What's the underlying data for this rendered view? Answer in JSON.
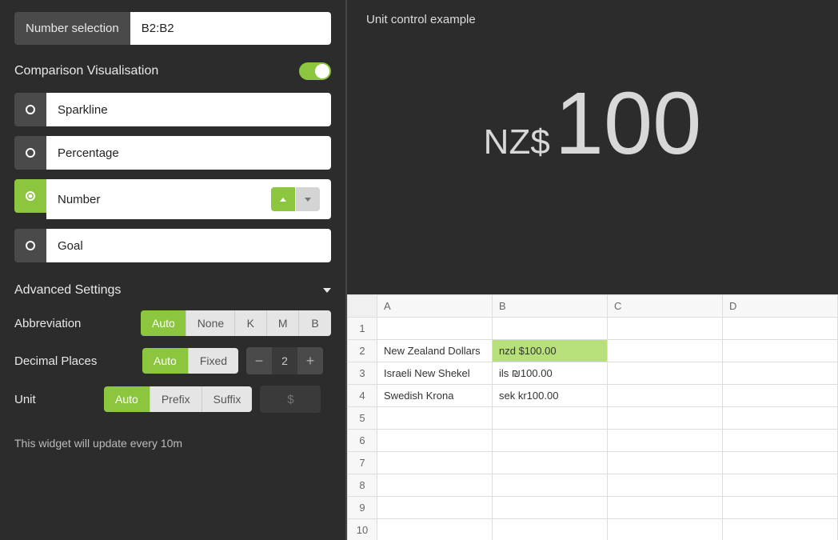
{
  "selection": {
    "label": "Number selection",
    "value": "B2:B2"
  },
  "comparison": {
    "title": "Comparison Visualisation",
    "enabled": true,
    "options": [
      {
        "label": "Sparkline",
        "selected": false,
        "expandable": false
      },
      {
        "label": "Percentage",
        "selected": false,
        "expandable": false
      },
      {
        "label": "Number",
        "selected": true,
        "expandable": true
      },
      {
        "label": "Goal",
        "selected": false,
        "expandable": false
      }
    ]
  },
  "advanced": {
    "title": "Advanced Settings",
    "abbreviation": {
      "label": "Abbreviation",
      "options": [
        "Auto",
        "None",
        "K",
        "M",
        "B"
      ],
      "active": "Auto"
    },
    "decimal": {
      "label": "Decimal Places",
      "options": [
        "Auto",
        "Fixed"
      ],
      "active": "Auto",
      "value": "2"
    },
    "unit": {
      "label": "Unit",
      "options": [
        "Auto",
        "Prefix",
        "Suffix"
      ],
      "active": "Auto",
      "placeholder": "$"
    }
  },
  "note": "This widget will update every 10m",
  "preview": {
    "title": "Unit control example",
    "prefix": "NZ$",
    "value": "100"
  },
  "sheet": {
    "columns": [
      "A",
      "B",
      "C",
      "D"
    ],
    "rows": [
      {
        "n": "1",
        "a": "",
        "b": "",
        "c": "",
        "d": ""
      },
      {
        "n": "2",
        "a": "New Zealand Dollars",
        "b": "nzd $100.00",
        "c": "",
        "d": "",
        "sel": true
      },
      {
        "n": "3",
        "a": "Israeli New Shekel",
        "b": "ils ₪100.00",
        "c": "",
        "d": ""
      },
      {
        "n": "4",
        "a": "Swedish Krona",
        "b": "sek kr100.00",
        "c": "",
        "d": ""
      },
      {
        "n": "5",
        "a": "",
        "b": "",
        "c": "",
        "d": ""
      },
      {
        "n": "6",
        "a": "",
        "b": "",
        "c": "",
        "d": ""
      },
      {
        "n": "7",
        "a": "",
        "b": "",
        "c": "",
        "d": ""
      },
      {
        "n": "8",
        "a": "",
        "b": "",
        "c": "",
        "d": ""
      },
      {
        "n": "9",
        "a": "",
        "b": "",
        "c": "",
        "d": ""
      },
      {
        "n": "10",
        "a": "",
        "b": "",
        "c": "",
        "d": ""
      }
    ]
  }
}
